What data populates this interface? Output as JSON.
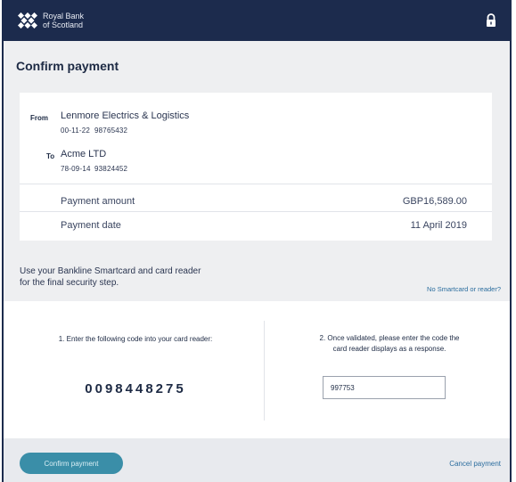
{
  "brand": {
    "name_line1": "Royal Bank",
    "name_line2": "of Scotland"
  },
  "header": {
    "title": "Confirm payment"
  },
  "payment": {
    "from": {
      "label": "From",
      "name": "Lenmore Electrics & Logistics",
      "sort_code": "00-11-22",
      "account": "98765432"
    },
    "to": {
      "label": "To",
      "name": "Acme LTD",
      "sort_code": "78-09-14",
      "account": "93824452"
    },
    "amount_label": "Payment amount",
    "amount_value": "GBP16,589.00",
    "date_label": "Payment date",
    "date_value": "11 April 2019"
  },
  "security": {
    "instruction_line1": "Use your Bankline Smartcard and card reader",
    "instruction_line2": "for the final security step.",
    "no_card_link": "No Smartcard or reader?"
  },
  "steps": {
    "step1_text": "1. Enter the following code into your card reader:",
    "code": "0098448275",
    "step2_line1": "2. Once validated, please enter the code the",
    "step2_line2": "card reader displays as a response.",
    "response_value": "997753"
  },
  "footer": {
    "confirm_label": "Confirm payment",
    "cancel_label": "Cancel payment"
  },
  "colors": {
    "brand_navy": "#1c2b4d",
    "confirm_button": "#3a8ea8",
    "link": "#2b6d9e"
  },
  "icons": {
    "logo": "daisy-logo-icon",
    "lock": "lock-icon"
  }
}
